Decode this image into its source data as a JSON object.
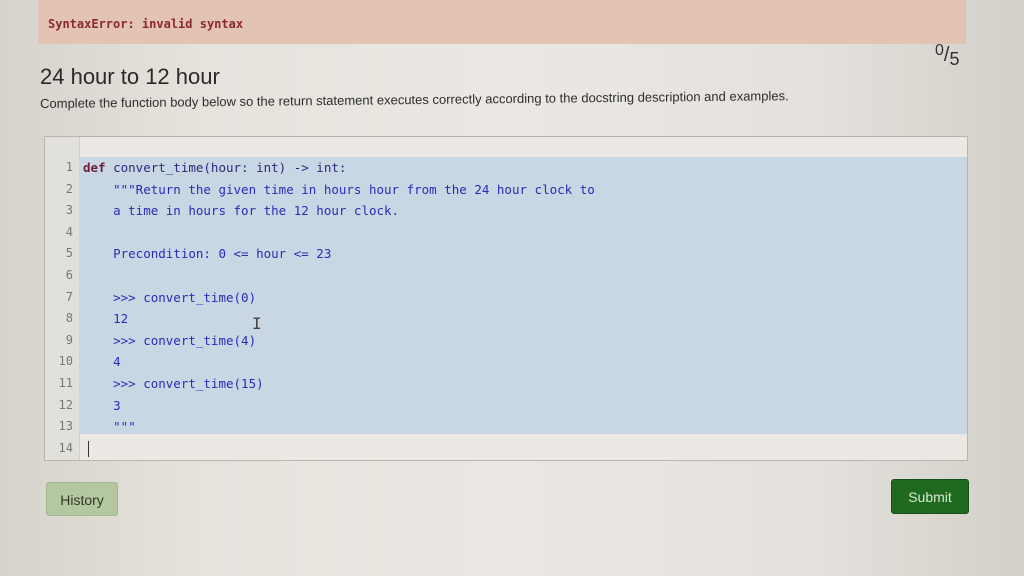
{
  "error": {
    "message": "SyntaxError: invalid syntax"
  },
  "score": {
    "earned": "0",
    "total": "5"
  },
  "problem": {
    "title": "24 hour to 12 hour",
    "instructions": "Complete the function body below so the return statement executes correctly according to the docstring description and examples."
  },
  "editor": {
    "lines": [
      {
        "number": "1",
        "keyword": "def",
        "text": " convert_time(hour: int) -> int:"
      },
      {
        "number": "2",
        "keyword": "",
        "text": "    \"\"\"Return the given time in hours hour from the 24 hour clock to"
      },
      {
        "number": "3",
        "keyword": "",
        "text": "    a time in hours for the 12 hour clock."
      },
      {
        "number": "4",
        "keyword": "",
        "text": ""
      },
      {
        "number": "5",
        "keyword": "",
        "text": "    Precondition: 0 <= hour <= 23"
      },
      {
        "number": "6",
        "keyword": "",
        "text": ""
      },
      {
        "number": "7",
        "keyword": "",
        "text": "    >>> convert_time(0)"
      },
      {
        "number": "8",
        "keyword": "",
        "text": "    12"
      },
      {
        "number": "9",
        "keyword": "",
        "text": "    >>> convert_time(4)"
      },
      {
        "number": "10",
        "keyword": "",
        "text": "    4"
      },
      {
        "number": "11",
        "keyword": "",
        "text": "    >>> convert_time(15)"
      },
      {
        "number": "12",
        "keyword": "",
        "text": "    3"
      },
      {
        "number": "13",
        "keyword": "",
        "text": "    \"\"\""
      },
      {
        "number": "14",
        "keyword": "",
        "text": ""
      }
    ]
  },
  "buttons": {
    "history": "History",
    "submit": "Submit"
  },
  "colors": {
    "error_bg": "#e3c3b3",
    "error_text": "#8a2a2a",
    "selection": "#c9d6e4",
    "code_text": "#2b2bb5",
    "keyword": "#6b1f3a",
    "submit_bg": "#1f6a1f",
    "history_bg": "#b5c7a1"
  }
}
